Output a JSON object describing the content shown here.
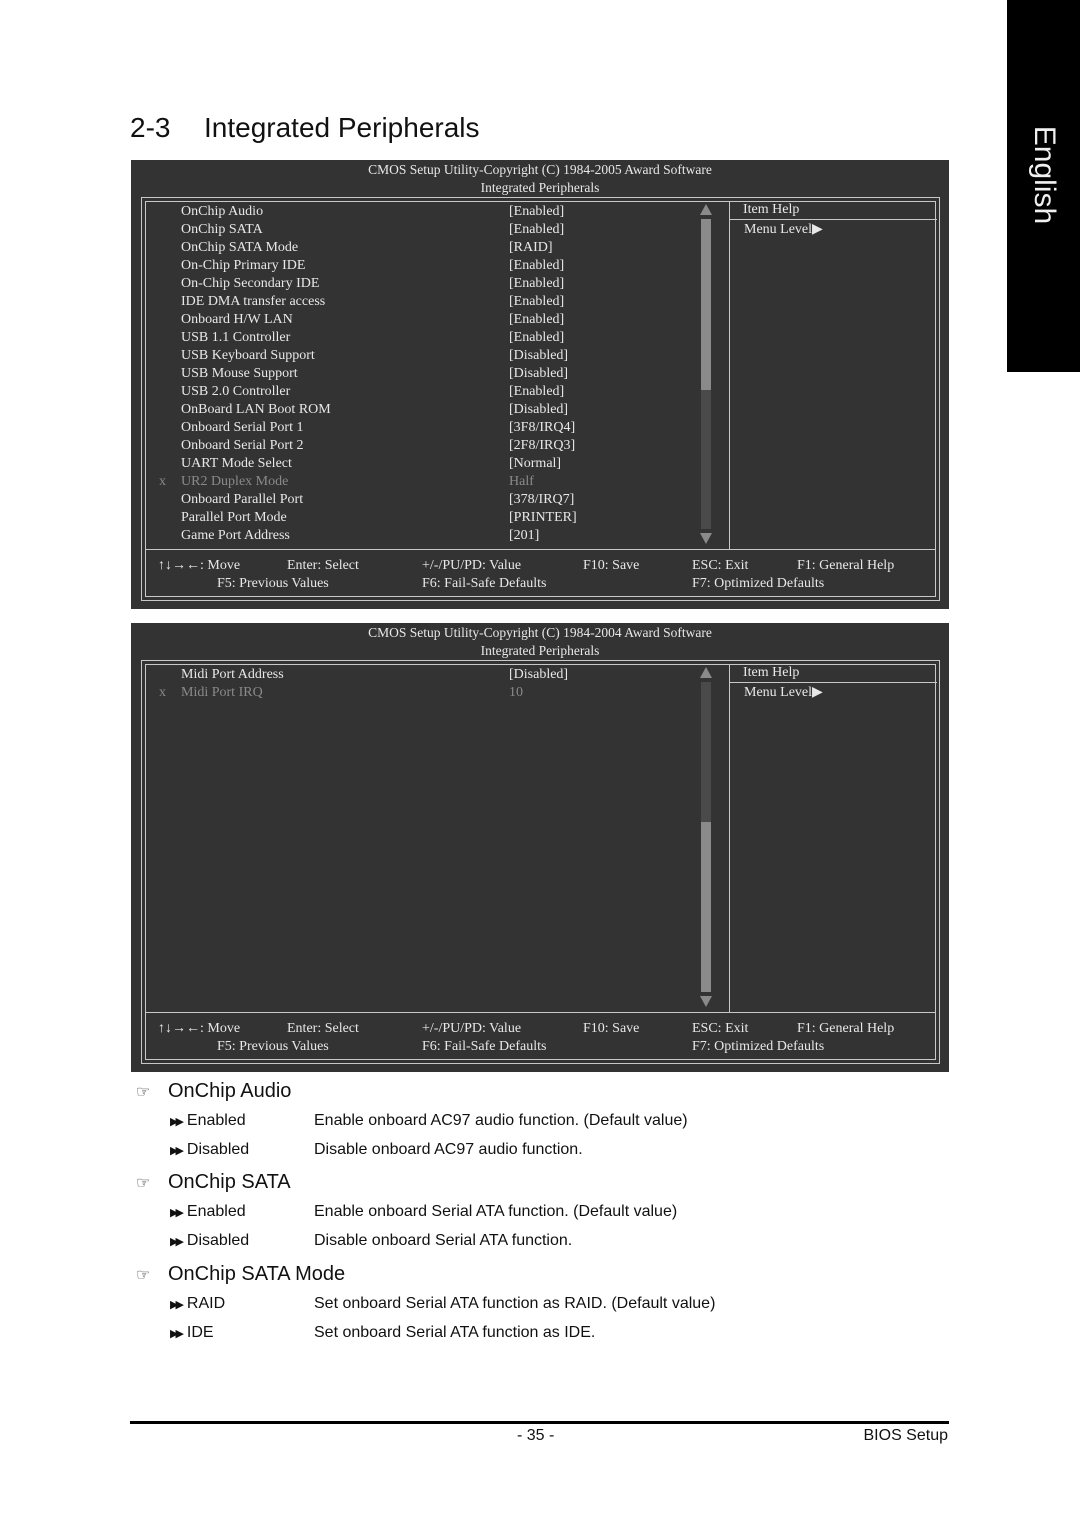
{
  "side_tab": {
    "label": "English"
  },
  "section": {
    "number": "2-3",
    "title": "Integrated Peripherals"
  },
  "panels": [
    {
      "header_line1": "CMOS Setup Utility-Copyright (C) 1984-2005 Award Software",
      "header_line2": "Integrated Peripherals",
      "items": [
        {
          "label": "OnChip Audio",
          "value": "[Enabled]",
          "disabled": false
        },
        {
          "label": "OnChip SATA",
          "value": "[Enabled]",
          "disabled": false
        },
        {
          "label": "OnChip SATA Mode",
          "value": "[RAID]",
          "disabled": false
        },
        {
          "label": "On-Chip Primary IDE",
          "value": "[Enabled]",
          "disabled": false
        },
        {
          "label": "On-Chip Secondary IDE",
          "value": "[Enabled]",
          "disabled": false
        },
        {
          "label": "IDE DMA transfer access",
          "value": "[Enabled]",
          "disabled": false
        },
        {
          "label": "Onboard H/W LAN",
          "value": "[Enabled]",
          "disabled": false
        },
        {
          "label": "USB 1.1 Controller",
          "value": "[Enabled]",
          "disabled": false
        },
        {
          "label": "USB Keyboard Support",
          "value": "[Disabled]",
          "disabled": false
        },
        {
          "label": "USB Mouse Support",
          "value": "[Disabled]",
          "disabled": false
        },
        {
          "label": "USB 2.0 Controller",
          "value": "[Enabled]",
          "disabled": false
        },
        {
          "label": "OnBoard LAN Boot ROM",
          "value": "[Disabled]",
          "disabled": false
        },
        {
          "label": "Onboard Serial Port 1",
          "value": "[3F8/IRQ4]",
          "disabled": false
        },
        {
          "label": "Onboard Serial Port 2",
          "value": "[2F8/IRQ3]",
          "disabled": false
        },
        {
          "label": "UART Mode Select",
          "value": "[Normal]",
          "disabled": false
        },
        {
          "label": "UR2 Duplex Mode",
          "value": "Half",
          "disabled": true,
          "marker": "x"
        },
        {
          "label": "Onboard Parallel Port",
          "value": "[378/IRQ7]",
          "disabled": false
        },
        {
          "label": "Parallel Port Mode",
          "value": "[PRINTER]",
          "disabled": false
        },
        {
          "label": "Game Port Address",
          "value": "[201]",
          "disabled": false
        }
      ],
      "scroll": {
        "thumb_start": 0.0,
        "thumb_end": 0.55
      },
      "help_title": "Item Help",
      "menu_level": "Menu Level",
      "keys": {
        "move": "↑↓→←: Move",
        "enter": "Enter: Select",
        "value": "+/-/PU/PD: Value",
        "save": "F10: Save",
        "exit": "ESC: Exit",
        "help": "F1: General Help",
        "f5": "F5: Previous Values",
        "f6": "F6: Fail-Safe Defaults",
        "f7": "F7: Optimized Defaults"
      }
    },
    {
      "header_line1": "CMOS Setup Utility-Copyright (C) 1984-2004 Award Software",
      "header_line2": "Integrated Peripherals",
      "items": [
        {
          "label": "Midi Port Address",
          "value": "[Disabled]",
          "disabled": false
        },
        {
          "label": "Midi Port IRQ",
          "value": "10",
          "disabled": true,
          "marker": "x"
        }
      ],
      "scroll": {
        "thumb_start": 0.45,
        "thumb_end": 1.0
      },
      "help_title": "Item Help",
      "menu_level": "Menu Level",
      "keys": {
        "move": "↑↓→←: Move",
        "enter": "Enter: Select",
        "value": "+/-/PU/PD: Value",
        "save": "F10: Save",
        "exit": "ESC: Exit",
        "help": "F1: General Help",
        "f5": "F5: Previous Values",
        "f6": "F6: Fail-Safe Defaults",
        "f7": "F7: Optimized Defaults"
      }
    }
  ],
  "descriptions": [
    {
      "title": "OnChip Audio",
      "options": [
        {
          "name": "Enabled",
          "desc": "Enable onboard AC97 audio function. (Default value)"
        },
        {
          "name": "Disabled",
          "desc": "Disable onboard AC97 audio function."
        }
      ]
    },
    {
      "title": "OnChip SATA",
      "options": [
        {
          "name": "Enabled",
          "desc": "Enable onboard Serial ATA function. (Default value)"
        },
        {
          "name": "Disabled",
          "desc": "Disable onboard Serial ATA function."
        }
      ]
    },
    {
      "title": "OnChip SATA Mode",
      "options": [
        {
          "name": "RAID",
          "desc": "Set onboard Serial ATA function as RAID. (Default value)"
        },
        {
          "name": "IDE",
          "desc": "Set onboard Serial ATA function as IDE."
        }
      ]
    }
  ],
  "icons": {
    "section_bullet": "pointing-hand-icon",
    "option_bullet": "double-arrow-icon",
    "menu_level": "right-triangle-icon"
  },
  "footer": {
    "page": "- 35 -",
    "chapter": "BIOS Setup"
  }
}
